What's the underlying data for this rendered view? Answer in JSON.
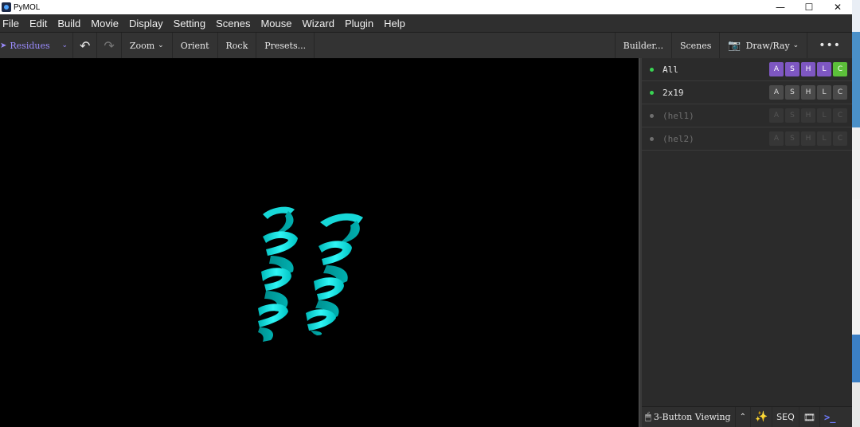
{
  "window": {
    "title": "PyMOL",
    "controls": {
      "minimize": "—",
      "maximize": "☐",
      "close": "✕"
    }
  },
  "menu": [
    "File",
    "Edit",
    "Build",
    "Movie",
    "Display",
    "Setting",
    "Scenes",
    "Mouse",
    "Wizard",
    "Plugin",
    "Help"
  ],
  "toolbar": {
    "selection_mode": "Residues",
    "undo_icon": "↶",
    "redo_icon": "↷",
    "zoom": "Zoom",
    "orient": "Orient",
    "rock": "Rock",
    "presets": "Presets...",
    "builder": "Builder...",
    "scenes": "Scenes",
    "draw_ray": "Draw/Ray",
    "more": "•••",
    "chevron": "⌄",
    "camera_icon": "📷",
    "pointer_icon": "➤"
  },
  "viewport": {
    "background": "#000000",
    "ribbon_color": "#00e5e5"
  },
  "objects": [
    {
      "name": "All",
      "enabled": true,
      "dot_color": "#39d353"
    },
    {
      "name": "2x19",
      "enabled": true,
      "dot_color": "#39d353"
    },
    {
      "name": "(hel1)",
      "enabled": false,
      "dot_color": "#6e6e6e"
    },
    {
      "name": "(hel2)",
      "enabled": false,
      "dot_color": "#6e6e6e"
    }
  ],
  "ashlc": [
    "A",
    "S",
    "H",
    "L",
    "C"
  ],
  "statusbar": {
    "mouse_icon": "🖱",
    "mouse_mode": "3-Button Viewing",
    "up_icon": "⌃",
    "wand_icon": "✨",
    "seq": "SEQ",
    "movie_icon": "🎞",
    "terminal_icon": ">_"
  }
}
